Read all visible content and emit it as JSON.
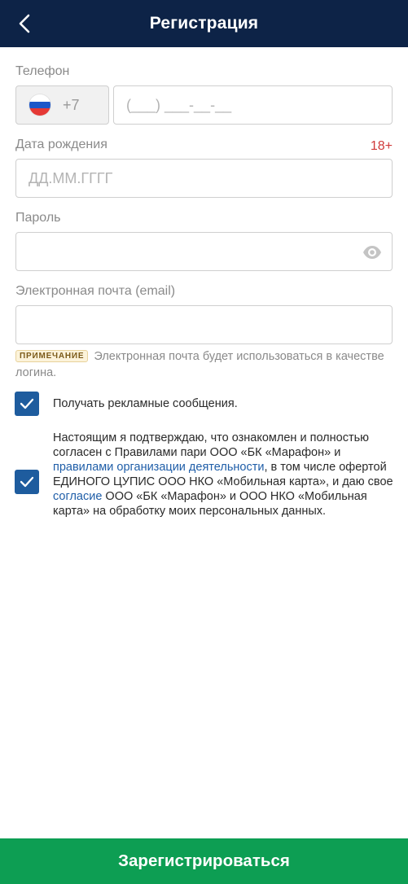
{
  "header": {
    "title": "Регистрация",
    "back_icon": "chevron-left-icon"
  },
  "phone": {
    "label": "Телефон",
    "country_code": "+7",
    "flag_colors": [
      "#ffffff",
      "#1c57c9",
      "#e53935"
    ],
    "placeholder": "(___) ___-__-__"
  },
  "birthdate": {
    "label": "Дата рождения",
    "age_badge": "18+",
    "placeholder": "ДД.ММ.ГГГГ"
  },
  "password": {
    "label": "Пароль",
    "value": "",
    "icon": "eye-icon"
  },
  "email": {
    "label": "Электронная почта (email)",
    "value": "",
    "note_badge": "ПРИМЕЧАНИЕ",
    "note_text": "Электронная почта будет использоваться в качестве логина."
  },
  "checkboxes": {
    "ads": {
      "checked": true,
      "label": "Получать рекламные сообщения."
    },
    "agreement": {
      "checked": true,
      "text_1": "Настоящим я подтверждаю, что ознакомлен и полностью согласен с Правилами пари ООО «БК «Марафон» и ",
      "link_1": "правилами организации деятельности",
      "text_2": ", в том числе офертой ЕДИНОГО ЦУПИС ООО НКО «Мобильная карта», и даю свое ",
      "link_2": "согласие",
      "text_3": " ООО «БК «Марафон» и ООО НКО «Мобильная карта» на обработку моих персональных данных."
    }
  },
  "submit": {
    "label": "Зарегистрироваться"
  },
  "colors": {
    "header_bg": "#0d2347",
    "checkbox": "#1e5c9e",
    "button": "#0d9e53",
    "age_badge": "#d03a3a",
    "link": "#1f5ea8"
  }
}
